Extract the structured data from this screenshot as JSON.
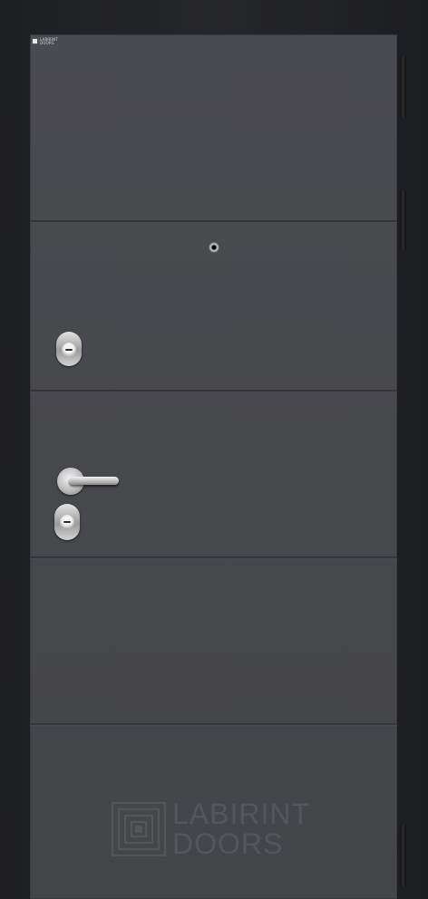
{
  "image": {
    "subject": "steel-entrance-door",
    "colors": {
      "frame": "#222326",
      "door_panel": "#48494d",
      "grooves": "#333437",
      "hardware": "#c4c4c4"
    }
  },
  "mini_logo": {
    "line1": "LABIRINT",
    "line2": "DOORS"
  },
  "brand": {
    "line1": "LABIRINT",
    "line2": "DOORS"
  },
  "icons": {
    "peephole": "peephole-icon",
    "lock_upper": "lock-cylinder-icon",
    "lock_lower": "lock-cylinder-icon",
    "handle": "lever-handle-icon",
    "brand_mark": "labirint-logo-icon"
  }
}
